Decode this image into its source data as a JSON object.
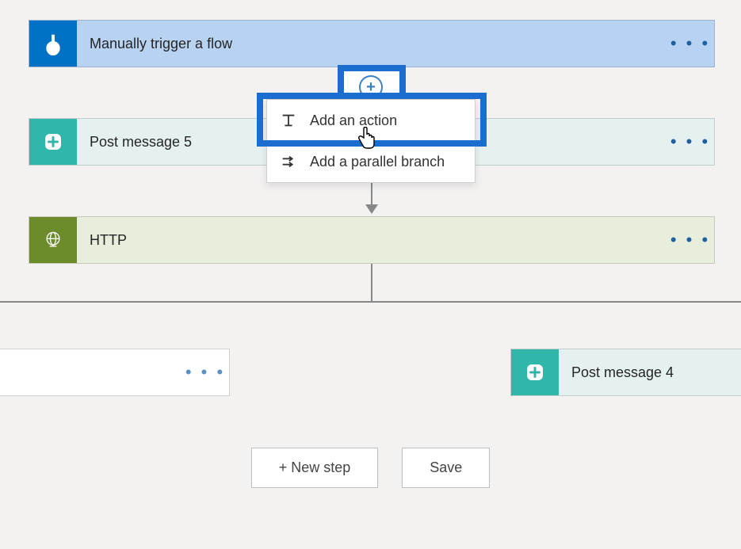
{
  "cards": {
    "trigger": {
      "label": "Manually trigger a flow"
    },
    "slack5": {
      "label": "Post message 5"
    },
    "http": {
      "label": "HTTP"
    },
    "slack4": {
      "label": "Post message 4"
    }
  },
  "dropdown": {
    "addAction": "Add an action",
    "addParallel": "Add a parallel branch"
  },
  "footer": {
    "newStep": "+ New step",
    "save": "Save"
  },
  "dotsGlyph": "• • •"
}
